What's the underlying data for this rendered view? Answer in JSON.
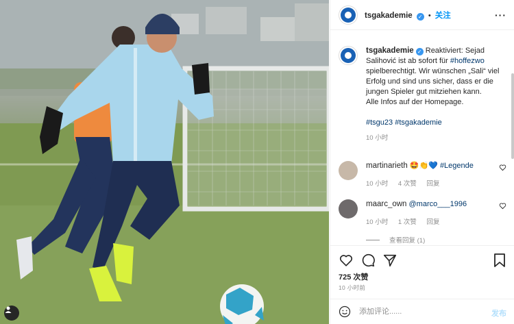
{
  "header": {
    "username": "tsgakademie",
    "follow_label": "关注",
    "more_label": "···"
  },
  "caption": {
    "username": "tsgakademie",
    "text_before_tag": "Reaktiviert: Sejad Salihović ist ab sofort für ",
    "tag1": "#hoffezwo",
    "text_after_tag": " spielberechtigt. Wir wünschen „Sali“ viel Erfolg und sind uns sicher, dass er die jungen Spieler gut mitziehen kann.",
    "text_line2": "Alle Infos auf der Homepage.",
    "tag2": "#tsgu23",
    "tag3": "#tsgakademie",
    "time": "10 小时"
  },
  "comments": [
    {
      "username": "martinarieth",
      "emojis": "🤩👏💙",
      "tag": "#Legende",
      "time": "10 小时",
      "likes": "4 次赞",
      "reply_label": "回复"
    },
    {
      "username": "maarc_own",
      "mention": "@marco___1996",
      "time": "10 小时",
      "likes": "1 次赞",
      "reply_label": "回复"
    }
  ],
  "view_replies_label": "查看回复 (1)",
  "likes_count": "725 次赞",
  "post_time": "10 小时前",
  "comment_input": {
    "placeholder": "添加评论......",
    "value": ""
  },
  "post_button_label": "发布",
  "colors": {
    "link": "#00376b",
    "follow": "#0095f6",
    "verified": "#3897f0",
    "post_disabled": "#b2dffc"
  }
}
